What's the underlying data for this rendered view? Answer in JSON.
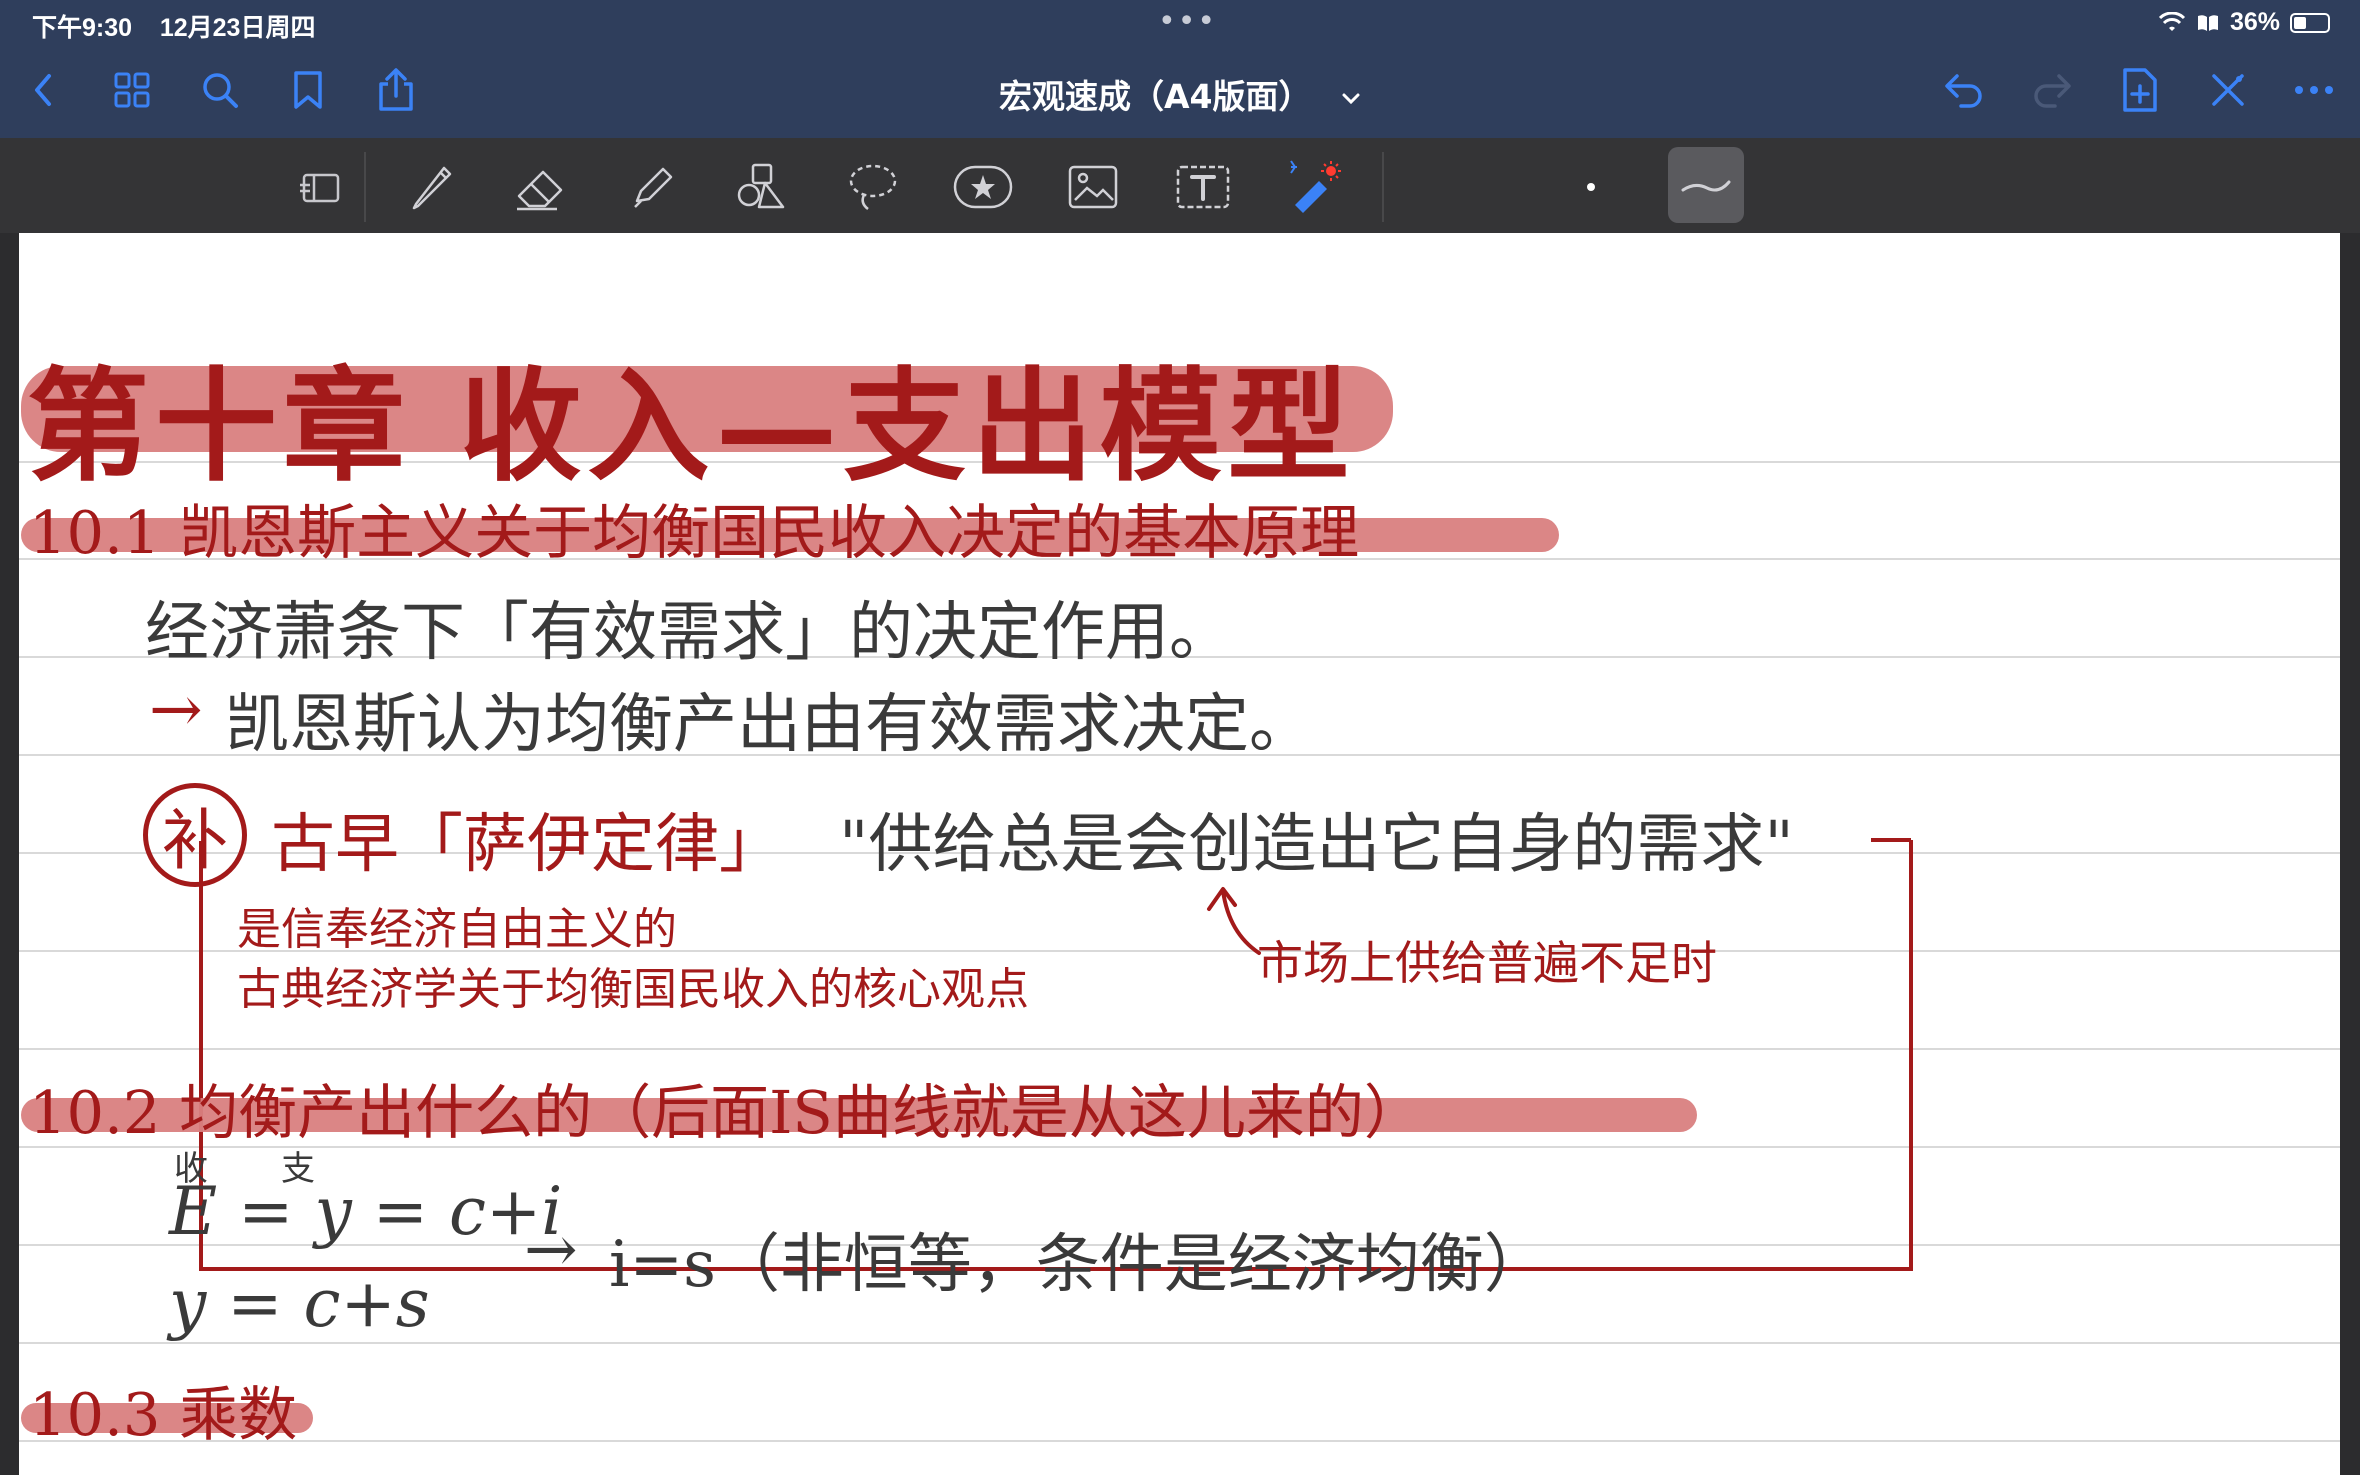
{
  "status": {
    "time": "下午9:30",
    "date": "12月23日周四",
    "battery": "36%",
    "battery_level": 0.36
  },
  "doc": {
    "title": "宏观速成（A4版面）"
  },
  "note": {
    "chapter": "第十章 收入—支出模型",
    "s101": "10.1 凯恩斯主义关于均衡国民收入决定的基本原理",
    "line1": "经济萧条下「有效需求」的决定作用。",
    "line2_arrow": "→",
    "line2": "凯恩斯认为均衡产出由有效需求决定。",
    "bu": "补",
    "saiyi": "古早「萨伊定律」",
    "quote": "\"供给总是会创造出它自身的需求\"",
    "note_a1": "是信奉经济自由主义的",
    "note_a2": "古典经济学关于均衡国民收入的核心观点",
    "note_b": "市场上供给普遍不足时",
    "s102": "10.2 均衡产出什么的（后面IS曲线就是从这儿来的）",
    "sup_shou": "收",
    "sup_zhi": "支",
    "eq1": "E = y = c+i",
    "eq2": "y = c+s",
    "eq3_arrow": "→",
    "eq3": "i=s（非恒等，条件是经济均衡）",
    "s103": "10.3 乘数"
  },
  "colors": {
    "nav": "#2f3e5c",
    "toolbar": "#343436",
    "accent": "#3b82f6",
    "ink_red": "#a31a1a",
    "highlight": "#d98080"
  }
}
